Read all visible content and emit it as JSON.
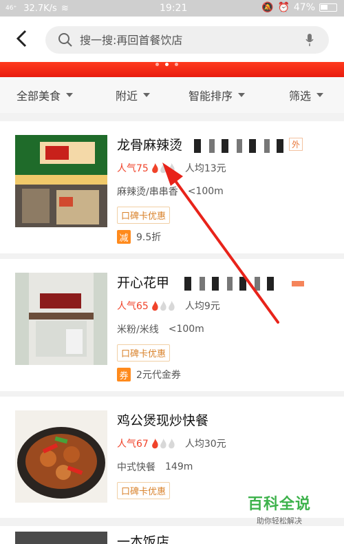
{
  "status_bar": {
    "signal": "46⁺",
    "speed": "32.7K/s",
    "time": "19:21",
    "battery": "47%"
  },
  "search": {
    "placeholder": "搜一搜:再回首餐饮店"
  },
  "filters": [
    "全部美食",
    "附近",
    "智能排序",
    "筛选"
  ],
  "restaurants": [
    {
      "name": "龙骨麻辣烫",
      "popularity": "人气75",
      "avg_price": "人均13元",
      "category": "麻辣烫/串串香",
      "distance": "<100m",
      "card_tag": "口碑卡优惠",
      "promo_badge": "减",
      "promo_text": "9.5折",
      "delivery_tag": "外"
    },
    {
      "name": "开心花甲",
      "popularity": "人气65",
      "avg_price": "人均9元",
      "category": "米粉/米线",
      "distance": "<100m",
      "card_tag": "口碑卡优惠",
      "promo_badge": "券",
      "promo_text": "2元代金券"
    },
    {
      "name": "鸡公煲现炒快餐",
      "popularity": "人气67",
      "avg_price": "人均30元",
      "category": "中式快餐",
      "distance": "149m",
      "card_tag": "口碑卡优惠"
    },
    {
      "name": "一本饭店"
    }
  ],
  "watermark": {
    "title": "百科全说",
    "subtitle": "助你轻松解决"
  },
  "colors": {
    "accent": "#f0432a",
    "banner": "#e81c0f",
    "tag_border": "#f1cfa4",
    "promo_badge": "#ff8a1c",
    "arrow": "#e8231a"
  }
}
